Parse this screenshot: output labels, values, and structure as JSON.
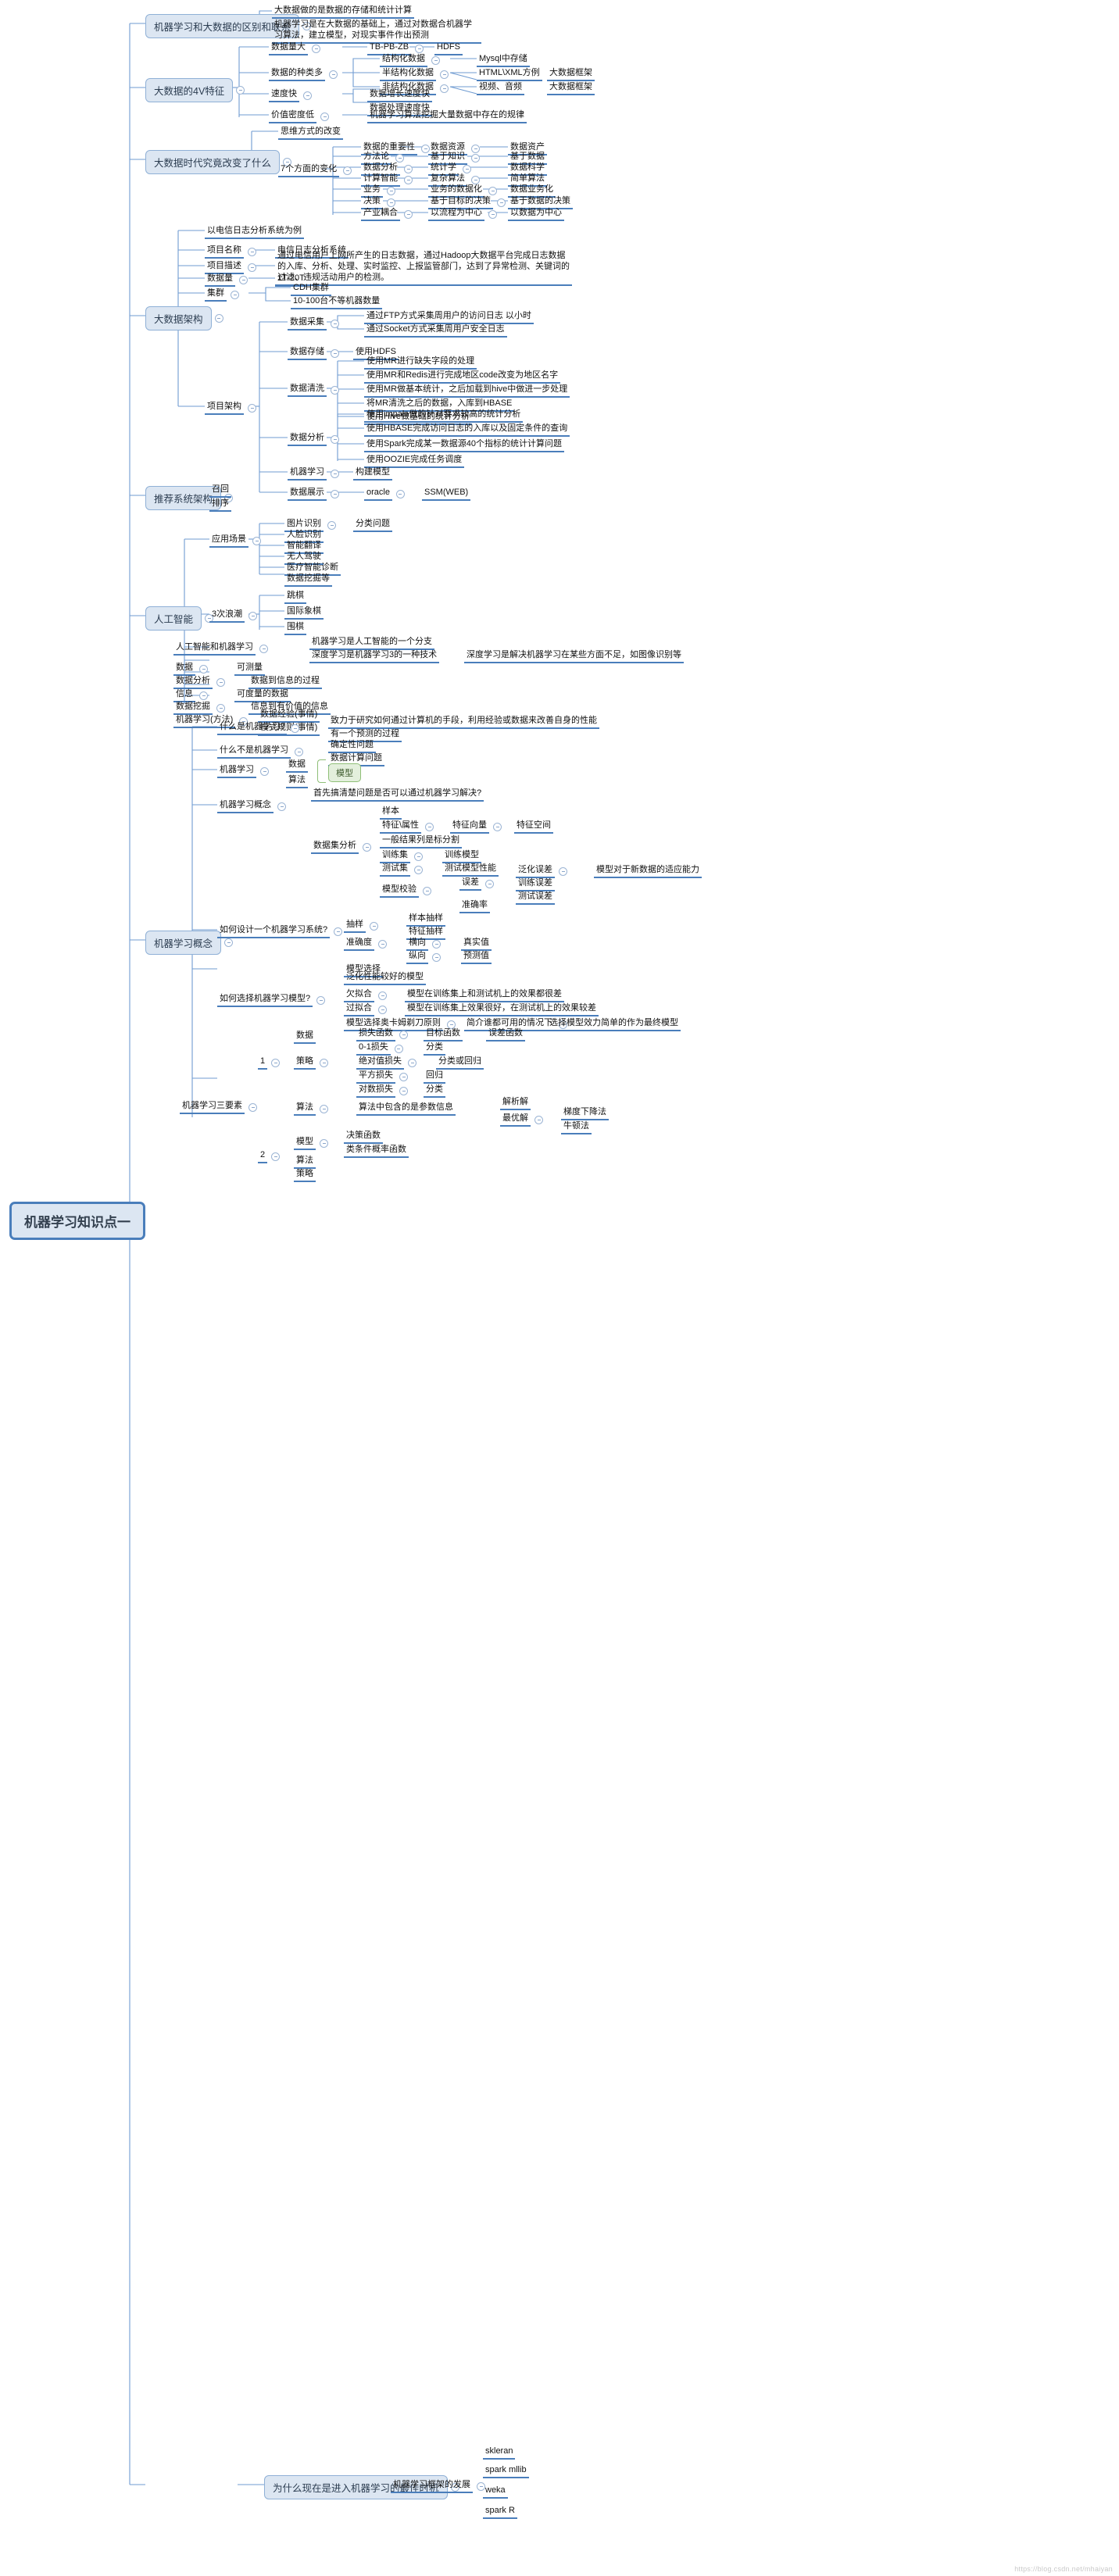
{
  "root": {
    "label": "机器学习知识点一"
  },
  "watermark": "https://blog.csdn.net/mhaiyan",
  "collapse_glyph": "−",
  "topics": [
    {
      "id": "t1",
      "label": "机器学习和大数据的区别和联系"
    },
    {
      "id": "t2",
      "label": "大数据的4V特征"
    },
    {
      "id": "t3",
      "label": "大数据时代究竟改变了什么"
    },
    {
      "id": "t4",
      "label": "大数据架构"
    },
    {
      "id": "t5",
      "label": "推荐系统架构"
    },
    {
      "id": "t6",
      "label": "人工智能"
    },
    {
      "id": "t7",
      "label": "机器学习概念"
    },
    {
      "id": "t8",
      "label": "为什么现在是进入机器学习的最佳时机"
    }
  ],
  "nodes": {
    "n_bigdata_def": "大数据做的是数据的存储和统计计算",
    "n_ml_def": "机器学习是在大数据的基础上，通过对数据合机器学习算法，建立模型，对现实事件作出预测",
    "v_volume": "数据量大",
    "v_volume_1": "TB-PB-ZB",
    "v_volume_2": "HDFS",
    "v_variety": "数据的种类多",
    "v_structured": "结构化数据",
    "v_structured_1": "Mysql中存储",
    "v_semi": "半结构化数据",
    "v_semi_1": "HTML\\XML方例",
    "v_semi_2": "大数据框架",
    "v_unstructured": "非结构化数据",
    "v_unstructured_1": "视频、音频",
    "v_unstructured_2": "大数据框架",
    "v_velocity": "速度快",
    "v_velocity_1": "数据增长速度快",
    "v_velocity_2": "数据处理速度快",
    "v_value": "价值密度低",
    "v_value_1": "机器学习算法挖掘大量数据中存在的规律",
    "c_think": "思维方式的改变",
    "c_seven": "7个方面的变化",
    "c_1a": "数据的重要性",
    "c_1b": "数据资源",
    "c_1c": "数据资产",
    "c_2a": "方法论",
    "c_2b": "基于知识",
    "c_2c": "基于数据",
    "c_3a": "数据分析",
    "c_3b": "统计学",
    "c_3c": "数据科学",
    "c_4a": "计算智能",
    "c_4b": "复杂算法",
    "c_4c": "简单算法",
    "c_5a": "业务",
    "c_5b": "业务的数据化",
    "c_5c": "数据业务化",
    "c_6a": "决策",
    "c_6b": "基于目标的决策",
    "c_6c": "基于数据的决策",
    "c_7a": "产业耦合",
    "c_7b": "以流程为中心",
    "c_7c": "以数据为中心",
    "a_example": "以电信日志分析系统为例",
    "a_name_k": "项目名称",
    "a_name_v": "电信日志分析系统",
    "a_desc_k": "项目描述",
    "a_desc_v": "通过电信用户上网所产生的日志数据，通过Hadoop大数据平台完成日志数据的入库、分析、处理、实时监控、上报监管部门，达到了异常检测、关键词的过滤、违规活动用户的检测。",
    "a_vol_k": "数据量",
    "a_vol_v": "1T-20T",
    "a_cluster_k": "集群",
    "a_cluster_v1": "CDH集群",
    "a_cluster_v2": "10-100台不等机器数量",
    "a_arch_k": "项目架构",
    "a_collect_k": "数据采集",
    "a_collect_1": "通过FTP方式采集周用户的访问日志    以小时",
    "a_collect_2": "通过Socket方式采集周用户安全日志",
    "a_store_k": "数据存储",
    "a_store_1": "使用HDFS",
    "a_clean_k": "数据清洗",
    "a_clean_1": "使用MR进行缺失字段的处理",
    "a_clean_2": "使用MR和Redis进行完成地区code改变为地区名字",
    "a_clean_3": "使用MR做基本统计，之后加载到hive中做进一步处理",
    "a_clean_4": "将MR清洗之后的数据，入库到HBASE",
    "a_clean_5": "使用Hive做基础的统计分析",
    "a_analysis_k": "数据分析",
    "a_analysis_1": "使用impala做的针对要求较高的统计分析",
    "a_analysis_2": "使用HBASE完成访问日志的入库以及固定条件的查询",
    "a_analysis_3": "使用Spark完成某一数据源40个指标的统计计算问题",
    "a_analysis_4": "使用OOZIE完成任务调度",
    "a_ml_k": "机器学习",
    "a_ml_1": "构建模型",
    "a_show_k": "数据展示",
    "a_show_1": "oracle",
    "a_show_2": "SSM(WEB)",
    "r_recall": "召回",
    "r_rank": "排序",
    "ai_scene_k": "应用场景",
    "ai_scene_1a": "图片识别",
    "ai_scene_1b": "分类问题",
    "ai_scene_2": "人脸识别",
    "ai_scene_3": "智能翻译",
    "ai_scene_4": "无人驾驶",
    "ai_scene_5": "医疗智能诊断",
    "ai_scene_6": "数据挖掘等",
    "ai_wave_k": "3次浪潮",
    "ai_wave_1": "跳棋",
    "ai_wave_2": "国际象棋",
    "ai_wave_3": "围棋",
    "ai_rel_k": "人工智能和机器学习",
    "ai_rel_1": "机器学习是人工智能的一个分支",
    "ai_rel_2": "深度学习是机器学习3的一种技术",
    "ai_rel_2b": "深度学习是解决机器学习在某些方面不足，如图像识别等",
    "ai_data_k": "数据",
    "ai_data_1": "可测量",
    "ai_dataan_k": "数据分析",
    "ai_dataan_1": "数据到信息的过程",
    "ai_info_k": "信息",
    "ai_info_1": "可度量的数据",
    "ai_mining_k": "数据挖掘",
    "ai_mining_1": "信息到有价值的信息",
    "ai_mlm_k": "机器学习(方法)",
    "ai_mlm_1": "数据经验(事情)",
    "ai_mlm_2": "模式规则(事情)",
    "m_what_k": "什么是机器学习?",
    "m_what_1": "致力于研究如何通过计算机的手段，利用经验或数据来改善自身的性能",
    "m_what_2": "有一个预测的过程",
    "m_notwhat_k": "什么不是机器学习",
    "m_notwhat_1": "确定性问题",
    "m_notwhat_2": "数据计算问题",
    "m_ml_k": "机器学习",
    "m_ml_1": "数据",
    "m_ml_2": "算法",
    "m_ml_model": "模型",
    "m_concept_k": "机器学习概念",
    "m_concept_1": "首先搞清楚问题是否可以通过机器学习解决?",
    "m_da_k": "数据集分析",
    "m_da_1": "样本",
    "m_da_2a": "特征\\属性",
    "m_da_2b": "特征向量",
    "m_da_2c": "特征空间",
    "m_da_3": "一般结果列是标分割",
    "m_da_4a": "训练集",
    "m_da_4b": "训练模型",
    "m_da_5a": "测试集",
    "m_da_5b": "测试模型性能",
    "m_da_6a": "模型校验",
    "m_da_6b": "误差",
    "m_da_6c": "泛化误差",
    "m_da_6d": "模型对于新数据的适应能力",
    "m_da_6e": "训练误差",
    "m_da_6f": "测试误差",
    "m_da_7": "准确率",
    "m_design_k": "如何设计一个机器学习系统?",
    "m_design_1a": "抽样",
    "m_design_1b": "样本抽样",
    "m_design_1c": "特征抽样",
    "m_design_2a": "准确度",
    "m_design_2b": "横向",
    "m_design_2c": "真实值",
    "m_design_2d": "纵向",
    "m_design_2e": "预测值",
    "m_design_3": "模型选择",
    "m_choose_k": "如何选择机器学习模型?",
    "m_choose_1": "泛化性能较好的模型",
    "m_choose_2a": "欠拟合",
    "m_choose_2b": "模型在训练集上和测试机上的效果都很差",
    "m_choose_3a": "过拟合",
    "m_choose_3b": "模型在训练集上效果很好，在测试机上的效果较差",
    "m_choose_4a": "模型选择奥卡姆剃刀原则",
    "m_choose_4b": "简介谁都可用的情况下",
    "m_choose_4c": "选择模型效力简单的作为最终模型",
    "m_three_k": "机器学习三要素",
    "m_g1": "1",
    "m_g1_data": "数据",
    "m_g1_strategy": "策略",
    "m_g1_s1a": "损失函数",
    "m_g1_s1b": "目标函数",
    "m_g1_s1c": "误差函数",
    "m_g1_s2a": "0-1损失",
    "m_g1_s2b": "分类",
    "m_g1_s3a": "绝对值损失",
    "m_g1_s3b": "分类或回归",
    "m_g1_s4a": "平方损失",
    "m_g1_s4b": "回归",
    "m_g1_s5a": "对数损失",
    "m_g1_s5b": "分类",
    "m_g1_alg": "算法",
    "m_g1_alg_1": "算法中包含的是参数信息",
    "m_g1_alg_2": "解析解",
    "m_g1_alg_3": "最优解",
    "m_g1_alg_3b": "梯度下降法",
    "m_g1_alg_3c": "牛顿法",
    "m_g2": "2",
    "m_g2_model": "模型",
    "m_g2_m1": "决策函数",
    "m_g2_m2": "类条件概率函数",
    "m_g2_alg": "算法",
    "m_g2_strategy": "策略",
    "w_dev": "机器学习框架的发展",
    "w_1": "skleran",
    "w_2": "spark mllib",
    "w_3": "weka",
    "w_4": "spark R"
  }
}
